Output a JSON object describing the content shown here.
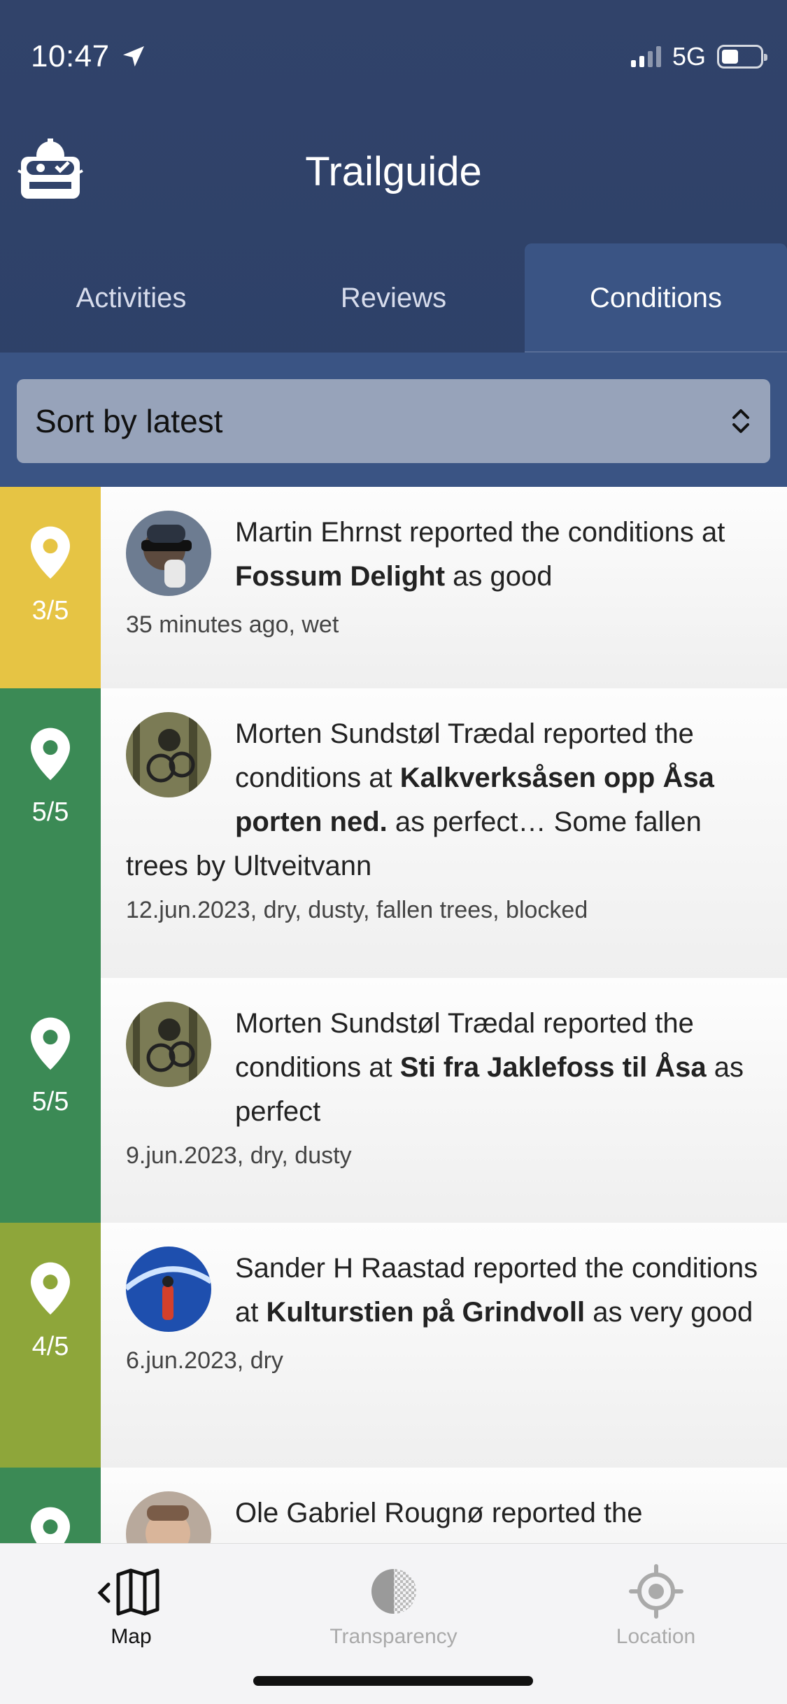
{
  "status_bar": {
    "time": "10:47",
    "network": "5G"
  },
  "app": {
    "title": "Trailguide"
  },
  "tabs": [
    {
      "label": "Activities"
    },
    {
      "label": "Reviews"
    },
    {
      "label": "Conditions"
    }
  ],
  "sort": {
    "selected": "Sort by latest"
  },
  "reports": [
    {
      "rating": "3/5",
      "color": "#e6c444",
      "user": "Martin Ehrnst",
      "pre": " reported the conditions at ",
      "trail": "Fossum Delight",
      "post": " as good",
      "meta": "35 minutes ago, wet"
    },
    {
      "rating": "5/5",
      "color": "#3b8a55",
      "user": "Morten Sundstøl Trædal",
      "pre": " reported the conditions at ",
      "trail": "Kalkverksåsen opp Åsa porten ned.",
      "post": " as perfect… Some fallen trees by Ultveitvann",
      "meta": "12.jun.2023, dry, dusty, fallen trees, blocked"
    },
    {
      "rating": "5/5",
      "color": "#3b8a55",
      "user": "Morten Sundstøl Trædal",
      "pre": " reported the conditions at ",
      "trail": "Sti fra Jaklefoss til Åsa",
      "post": " as perfect",
      "meta": "9.jun.2023, dry, dusty"
    },
    {
      "rating": "4/5",
      "color": "#8ea63a",
      "user": "Sander H Raastad",
      "pre": " reported the conditions at ",
      "trail": "Kulturstien på Grindvoll",
      "post": " as very good",
      "meta": "6.jun.2023, dry"
    },
    {
      "rating": "",
      "color": "#3b8a55",
      "user": "Ole Gabriel Rougnø",
      "pre": " reported the",
      "trail": "",
      "post": "",
      "meta": ""
    }
  ],
  "bottom_nav": [
    {
      "label": "Map",
      "icon": "map-icon"
    },
    {
      "label": "Transparency",
      "icon": "transparency-icon"
    },
    {
      "label": "Location",
      "icon": "location-icon"
    }
  ]
}
